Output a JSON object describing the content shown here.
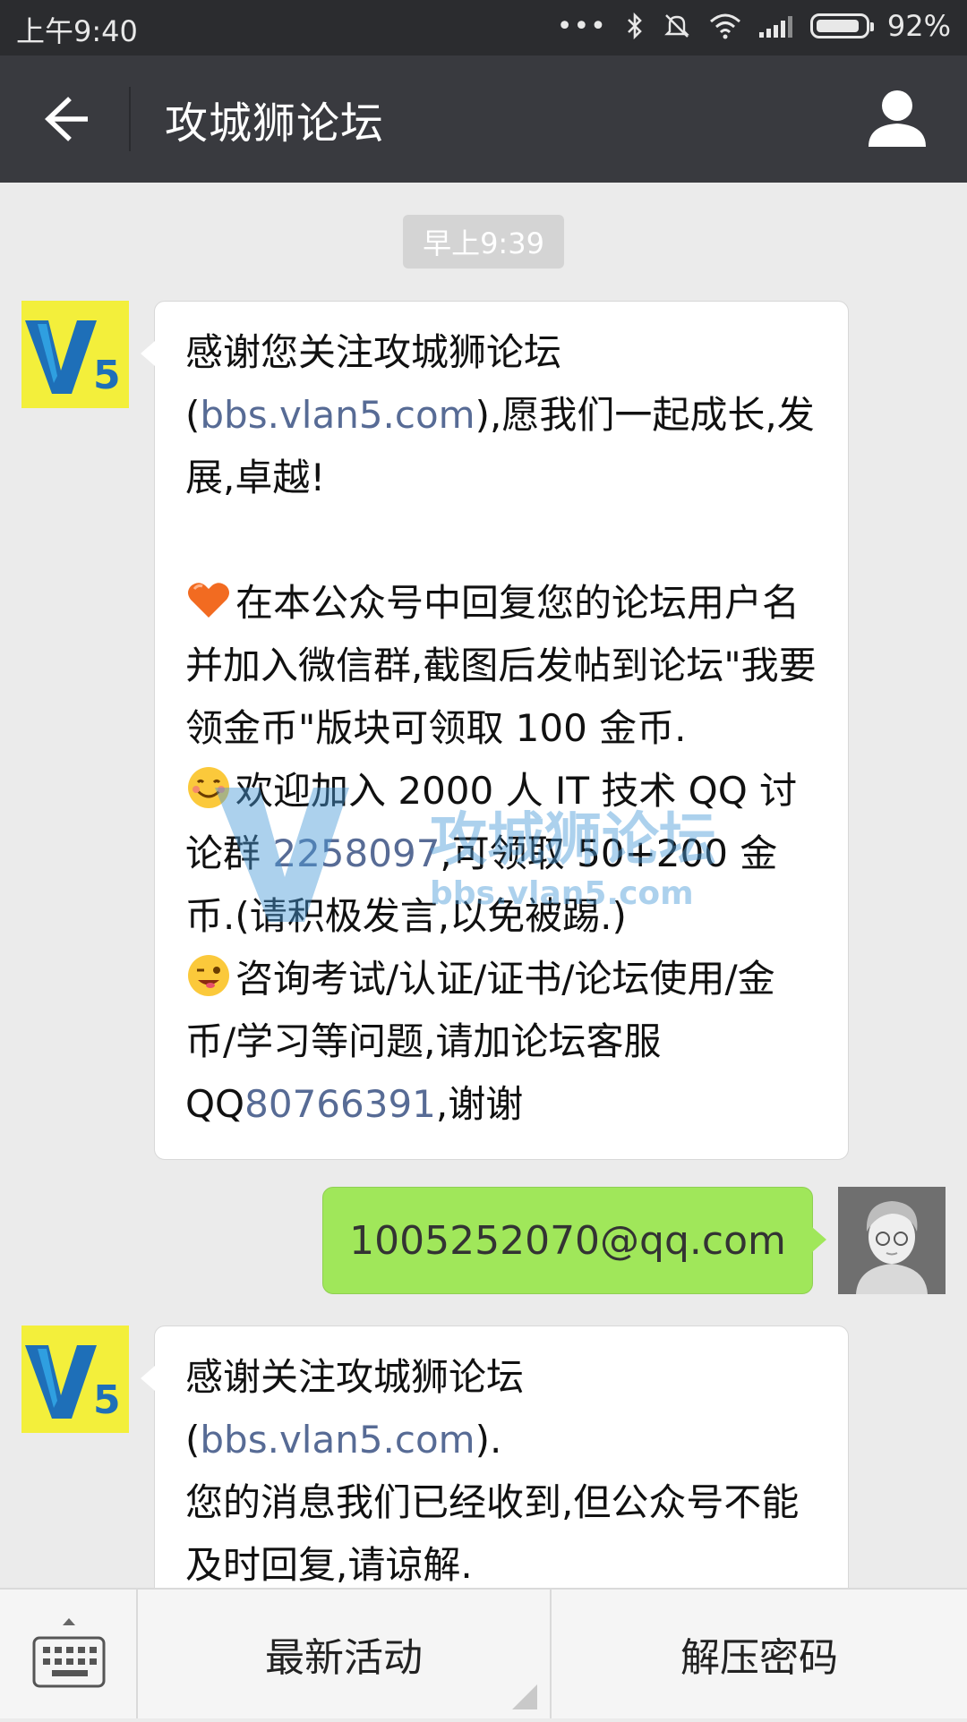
{
  "status_bar": {
    "time": "上午9:40",
    "battery": "92%",
    "battery_level": 0.92,
    "icons": [
      "more-dots-icon",
      "bluetooth-icon",
      "mute-icon",
      "wifi-icon",
      "signal-icon",
      "battery-icon"
    ]
  },
  "header": {
    "title": "攻城狮论坛",
    "back_icon": "back-arrow-icon",
    "profile_icon": "person-icon"
  },
  "chat": {
    "timestamp": "早上9:39",
    "messages": [
      {
        "from": "official-account",
        "avatar_text": "V5",
        "intro_text": "感谢您关注攻城狮论坛(",
        "intro_link": "bbs.vlan5.com",
        "intro_tail": "),愿我们一起成长,发展,卓越!",
        "item1_text": "在本公众号中回复您的论坛用户名并加入微信群,截图后发帖到论坛\"我要领金币\"版块可领取 100 金币.",
        "item2_pre": "欢迎加入 2000 人 IT 技术 QQ 讨论群 ",
        "item2_link": "2258097",
        "item2_post": ",可领取 50+200 金币.(请积极发言,以免被踢.)",
        "item3_pre": "咨询考试/认证/证书/论坛使用/金币/学习等问题,请加论坛客服QQ",
        "item3_link": "80766391",
        "item3_post": ",谢谢"
      },
      {
        "from": "me",
        "text": "1005252070@qq.com"
      },
      {
        "from": "official-account",
        "avatar_text": "V5",
        "intro_text": "感谢关注攻城狮论坛(",
        "intro_link": "bbs.vlan5.com",
        "intro_tail": ").",
        "line2": "您的消息我们已经收到,但公众号不能及时回复,请谅解."
      }
    ]
  },
  "watermark": {
    "logo": "V5",
    "name": "攻城狮论坛",
    "site": "bbs.vlan5.com"
  },
  "bottom_menu": {
    "keyboard_icon": "keyboard-icon",
    "items": [
      {
        "label": "最新活动"
      },
      {
        "label": "解压密码"
      }
    ]
  }
}
